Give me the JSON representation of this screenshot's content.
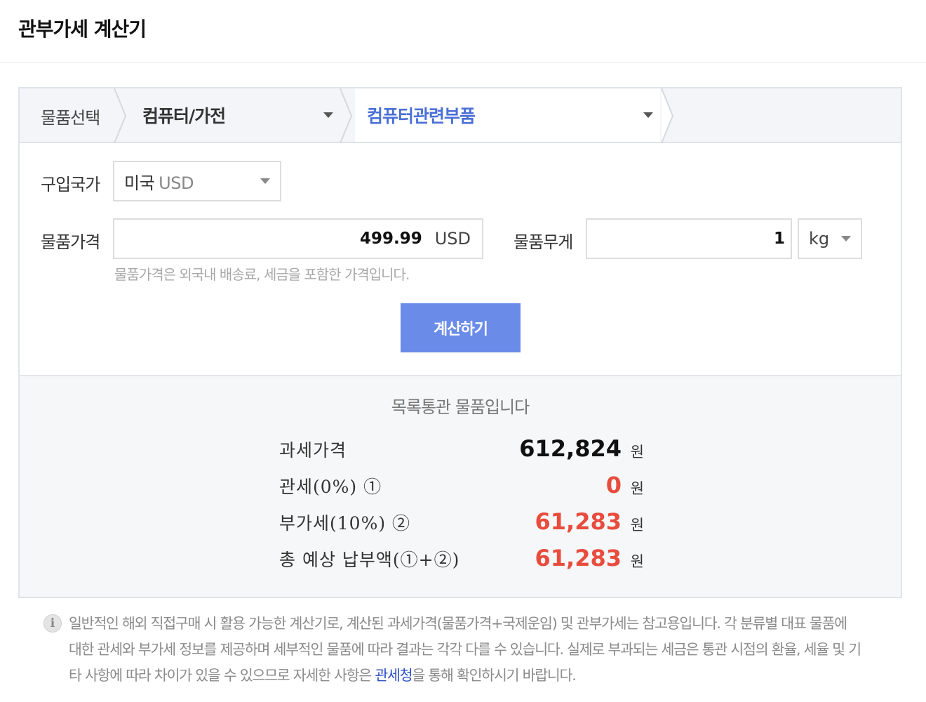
{
  "title": "관부가세 계산기",
  "breadcrumb": {
    "first": "물품선택",
    "category": "컴퓨터/가전",
    "subcategory": "컴퓨터관련부품"
  },
  "form": {
    "country_label": "구입국가",
    "country_name": "미국",
    "country_currency": "USD",
    "price_label": "물품가격",
    "price_value": "499.99",
    "price_unit": "USD",
    "weight_label": "물품무게",
    "weight_value": "1",
    "weight_unit": "kg",
    "hint": "물품가격은 외국내 배송료, 세금을 포함한 가격입니다.",
    "calc_button": "계산하기"
  },
  "result": {
    "status": "목록통관 물품입니다",
    "rows": [
      {
        "label": "과세가격",
        "value": "612,824",
        "unit": "원"
      },
      {
        "label": "관세(0%) ①",
        "value": "0",
        "unit": "원"
      },
      {
        "label": "부가세(10%) ②",
        "value": "61,283",
        "unit": "원"
      },
      {
        "label": "총 예상 납부액(①+②)",
        "value": "61,283",
        "unit": "원"
      }
    ]
  },
  "notice": {
    "icon": "info-icon",
    "text_before": "일반적인 해외 직접구매 시 활용 가능한 계산기로, 계산된 과세가격(물품가격+국제운임) 및 관부가세는 참고용입니다. 각 분류별 대표 물품에 대한 관세와 부가세 정보를 제공하며 세부적인 물품에 따라 결과는 각각 다를 수 있습니다. 실제로 부과되는 세금은 통관 시점의 환율, 세율 및 기타 사항에 따라 차이가 있을 수 있으므로 자세한 사항은 ",
    "link": "관세청",
    "text_after": "을 통해 확인하시기 바랍니다."
  },
  "colors": {
    "accent": "#6a8ce8",
    "link": "#2c4fc4",
    "breadcrumb_active": "#4a6fd6",
    "amount_red": "#e84c3d"
  }
}
